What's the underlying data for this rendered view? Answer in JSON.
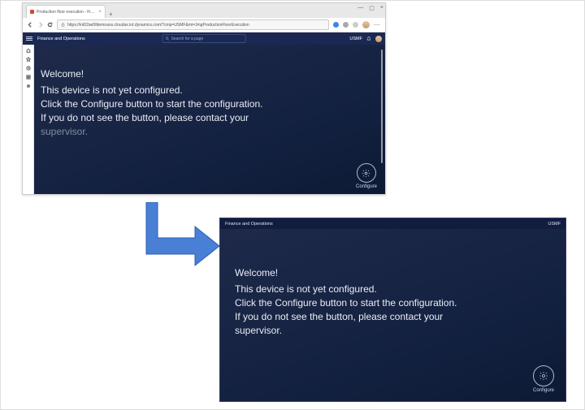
{
  "browser": {
    "tab_title": "Production floor execution - Fi…",
    "url": "https://int02ae5fdemoaos.cloudax.int.dynamics.com/?cmp=USMF&mi=JmgProductionFloorExecution"
  },
  "app": {
    "brand": "Finance and Operations",
    "search_placeholder": "Search for a page",
    "company": "USMF"
  },
  "before": {
    "welcome": "Welcome!",
    "line1": "This device is not yet configured.",
    "line2": "Click the Configure button to start the configuration.",
    "line3": "If you do not see the button, please contact your",
    "line4": "supervisor.",
    "configure_label": "Configure"
  },
  "after": {
    "welcome": "Welcome!",
    "line1": "This device is not yet configured.",
    "line2": "Click the Configure button to start the configuration.",
    "line3": "If you do not see the button, please contact your",
    "line4": "supervisor.",
    "configure_label": "Configure"
  }
}
